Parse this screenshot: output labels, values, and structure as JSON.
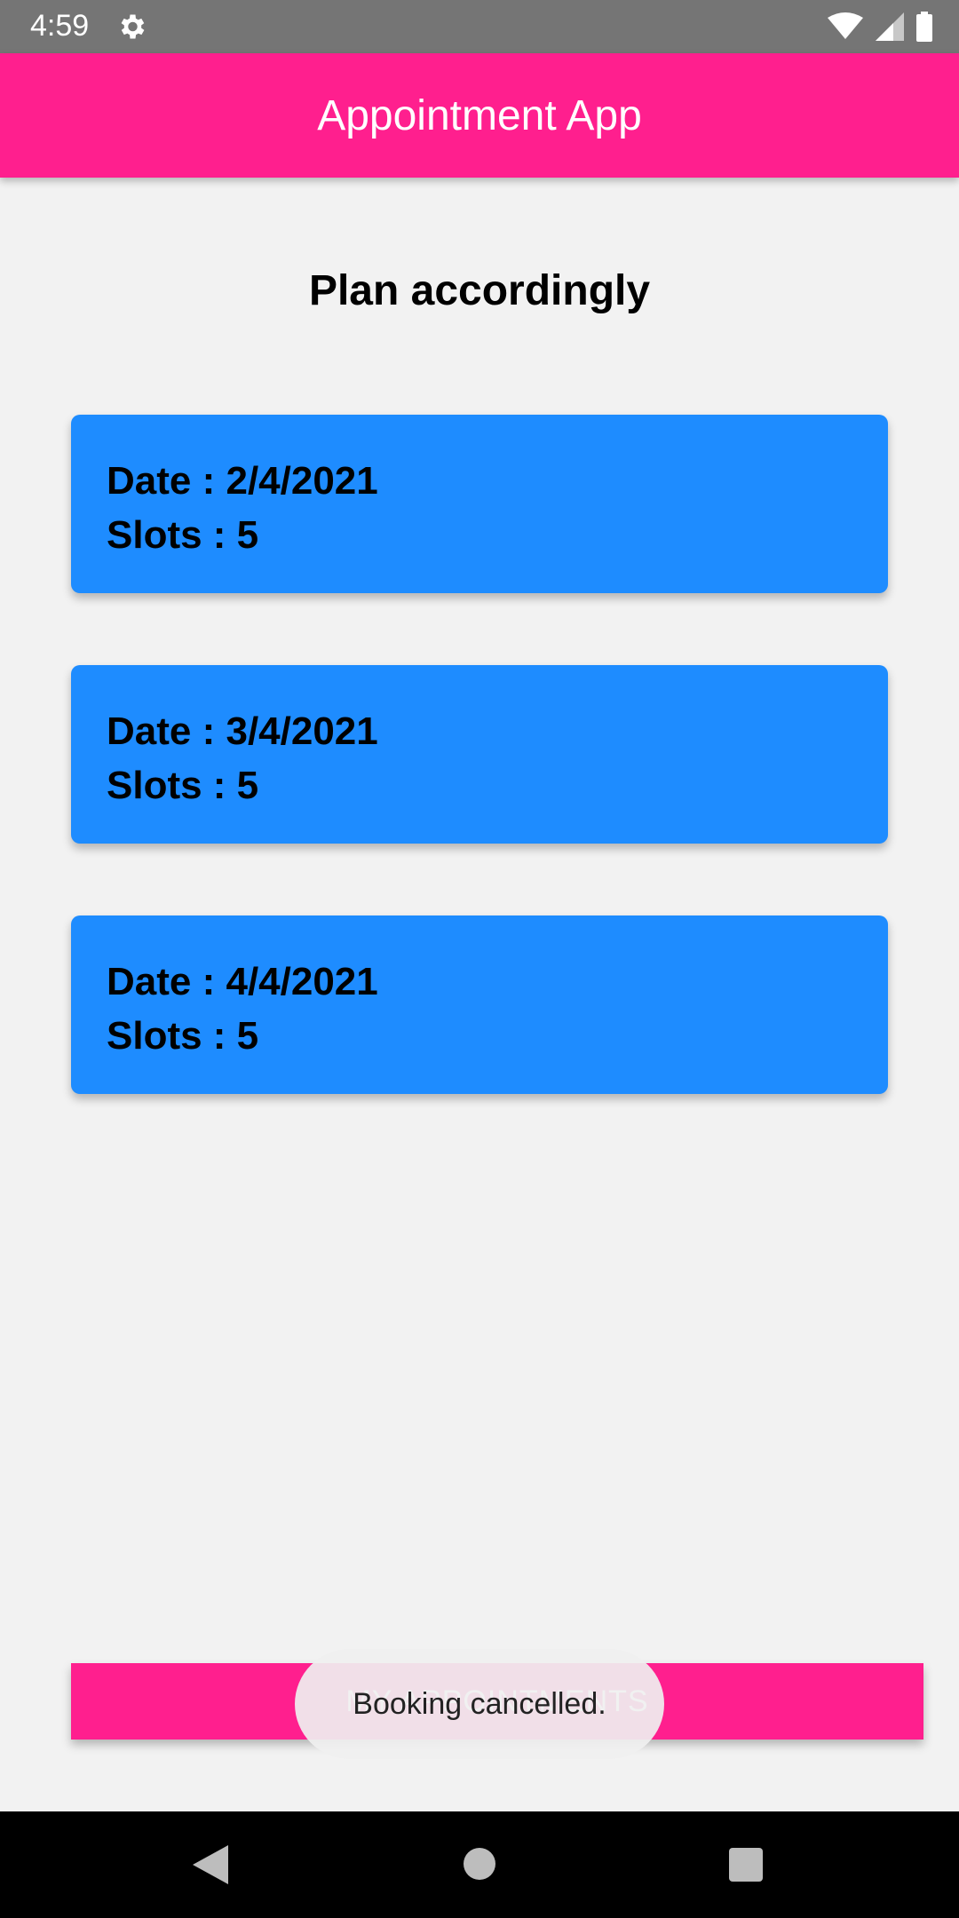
{
  "status_bar": {
    "time": "4:59",
    "icons": [
      "gear-icon",
      "wifi-icon",
      "signal-icon",
      "battery-icon"
    ]
  },
  "app_bar": {
    "title": "Appointment App"
  },
  "main": {
    "heading": "Plan accordingly",
    "cards": [
      {
        "date": "Date : 2/4/2021",
        "slots": "Slots : 5"
      },
      {
        "date": "Date : 3/4/2021",
        "slots": "Slots : 5"
      },
      {
        "date": "Date : 4/4/2021",
        "slots": "Slots : 5"
      }
    ]
  },
  "bottom_button": {
    "label": "MY APPOINTMENTS"
  },
  "toast": {
    "message": "Booking cancelled."
  },
  "nav_bar": {
    "icons": [
      "back-icon",
      "home-icon",
      "recents-icon"
    ]
  },
  "colors": {
    "accent": "#ff1f8e",
    "card": "#1e8cff",
    "background": "#f2f2f2",
    "status_bar": "#757575"
  }
}
